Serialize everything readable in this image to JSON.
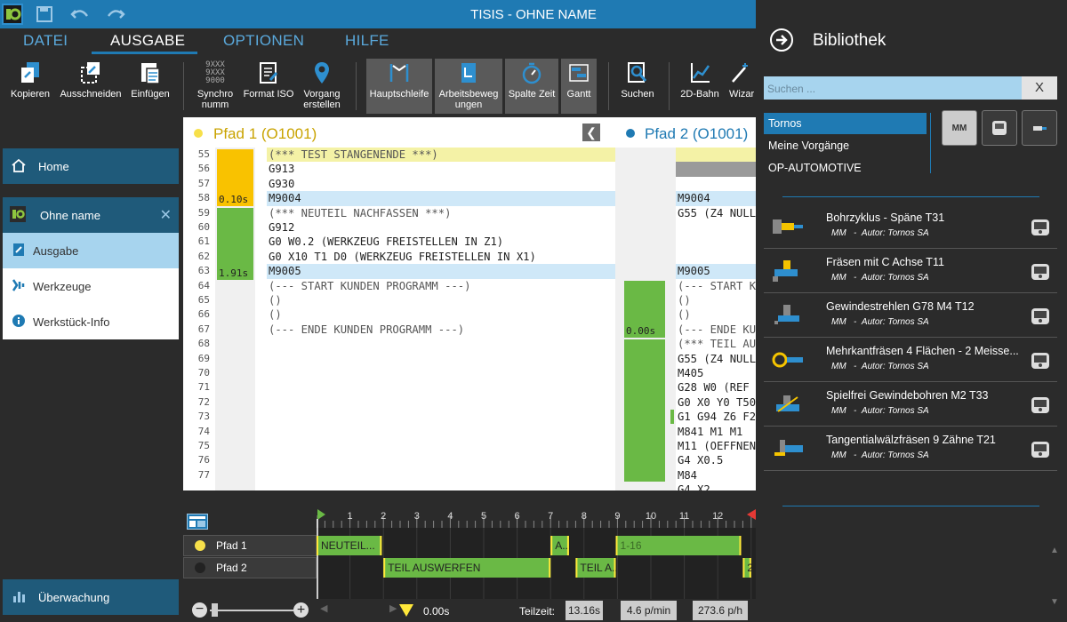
{
  "window": {
    "title": "TISIS - OHNE NAME"
  },
  "menu": {
    "tabs": [
      {
        "label": "DATEI"
      },
      {
        "label": "AUSGABE"
      },
      {
        "label": "OPTIONEN"
      },
      {
        "label": "HILFE"
      }
    ]
  },
  "ribbon": {
    "kopieren": "Kopieren",
    "ausschneiden": "Ausschneiden",
    "einfuegen": "Einfügen",
    "synchro": "Synchro\nnumm",
    "synchro_icon_text": "9XXX\n9XXX\n9000",
    "format_iso": "Format ISO",
    "vorgang": "Vorgang\nerstellen",
    "hauptschleife": "Hauptschleife",
    "arbeitsbewegungen": "Arbeitsbeweg\nungen",
    "spalte_zeit": "Spalte Zeit",
    "gantt": "Gantt",
    "suchen": "Suchen",
    "bahn2d": "2D-Bahn",
    "wizard": "Wizar"
  },
  "nav": {
    "home": "Home",
    "document": "Ohne name",
    "ausgabe": "Ausgabe",
    "werkzeuge": "Werkzeuge",
    "werkstueck": "Werkstück-Info",
    "ueberwachung": "Überwachung"
  },
  "path1": {
    "title": "Pfad 1 (O1001)",
    "dot_color": "#f7e04a",
    "time_a": "0.10s",
    "time_b": "1.91s",
    "lines": [
      {
        "n": "55",
        "code": "(*** TEST STANGENENDE ***)",
        "hl": "y"
      },
      {
        "n": "56",
        "code": "G913",
        "hl": ""
      },
      {
        "n": "57",
        "code": "G930",
        "hl": ""
      },
      {
        "n": "58",
        "code": "M9004",
        "hl": "b"
      },
      {
        "n": "59",
        "code": "(*** NEUTEIL NACHFASSEN ***)",
        "hl": ""
      },
      {
        "n": "60",
        "code": "G912",
        "hl": ""
      },
      {
        "n": "61",
        "code": "G0 W0.2 (WERKZEUG FREISTELLEN IN Z1)",
        "hl": ""
      },
      {
        "n": "62",
        "code": "G0 X10 T1 D0 (WERKZEUG FREISTELLEN IN X1)",
        "hl": ""
      },
      {
        "n": "63",
        "code": "M9005",
        "hl": "b"
      },
      {
        "n": "64",
        "code": "(--- START KUNDEN PROGRAMM ---)",
        "hl": ""
      },
      {
        "n": "65",
        "code": "()",
        "hl": ""
      },
      {
        "n": "66",
        "code": "()",
        "hl": ""
      },
      {
        "n": "67",
        "code": "(--- ENDE KUNDEN PROGRAMM ---)",
        "hl": ""
      },
      {
        "n": "68",
        "code": "",
        "hl": ""
      },
      {
        "n": "69",
        "code": "",
        "hl": ""
      },
      {
        "n": "70",
        "code": "",
        "hl": ""
      },
      {
        "n": "71",
        "code": "",
        "hl": ""
      },
      {
        "n": "72",
        "code": "",
        "hl": ""
      },
      {
        "n": "73",
        "code": "",
        "hl": ""
      },
      {
        "n": "74",
        "code": "",
        "hl": ""
      },
      {
        "n": "75",
        "code": "",
        "hl": ""
      },
      {
        "n": "76",
        "code": "",
        "hl": ""
      },
      {
        "n": "77",
        "code": "",
        "hl": ""
      }
    ]
  },
  "path2": {
    "title": "Pfad 2 (O1001)",
    "dot_color": "#1f7ab3",
    "time_a": "0.00s",
    "lines": [
      {
        "code": "",
        "hl": "y"
      },
      {
        "code": "",
        "hl": "g"
      },
      {
        "code": "",
        "hl": ""
      },
      {
        "code": "M9004",
        "hl": "b"
      },
      {
        "code": "G55 (Z4 NULL",
        "hl": ""
      },
      {
        "code": "",
        "hl": ""
      },
      {
        "code": "",
        "hl": ""
      },
      {
        "code": "",
        "hl": ""
      },
      {
        "code": "M9005",
        "hl": "b"
      },
      {
        "code": "(--- START K",
        "hl": ""
      },
      {
        "code": "()",
        "hl": ""
      },
      {
        "code": "()",
        "hl": ""
      },
      {
        "code": "(--- ENDE KU",
        "hl": ""
      },
      {
        "code": "(*** TEIL AU",
        "hl": ""
      },
      {
        "code": "G55 (Z4 NULL",
        "hl": ""
      },
      {
        "code": "M405",
        "hl": ""
      },
      {
        "code": "G28 W0 (REF",
        "hl": ""
      },
      {
        "code": "G0 X0 Y0 T50",
        "hl": ""
      },
      {
        "code": "G1 G94 Z6 F2",
        "hl": ""
      },
      {
        "code": "M841 M1 M1",
        "hl": ""
      },
      {
        "code": "M11 (OEFFNEN",
        "hl": ""
      },
      {
        "code": "G4 X0.5",
        "hl": ""
      },
      {
        "code": "M84",
        "hl": ""
      },
      {
        "code": "G4 X2",
        "hl": ""
      }
    ]
  },
  "gantt": {
    "ticks": [
      "1",
      "2",
      "3",
      "4",
      "5",
      "6",
      "7",
      "8",
      "9",
      "10",
      "11",
      "12"
    ],
    "rows": [
      {
        "label": "Pfad 1",
        "dot": "#f7e04a",
        "bars": [
          {
            "start": 0,
            "end": 1.95,
            "text": "NEUTEIL..."
          },
          {
            "start": 7.0,
            "end": 7.55,
            "text": "A..."
          },
          {
            "start": 8.95,
            "end": 12.7,
            "text": "1-16"
          }
        ]
      },
      {
        "label": "Pfad 2",
        "dot": "#222222",
        "bars": [
          {
            "start": 2.0,
            "end": 7.0,
            "text": "TEIL AUSWERFEN"
          },
          {
            "start": 7.75,
            "end": 8.95,
            "text": "TEIL A..."
          },
          {
            "start": 12.75,
            "end": 13.0,
            "text": "2..."
          }
        ]
      }
    ],
    "footer": {
      "time": "0.00s",
      "teilzeit_label": "Teilzeit:",
      "teilzeit": "13.16s",
      "rate_min": "4.6 p/min",
      "rate_h": "273.6 p/h"
    }
  },
  "library": {
    "title": "Bibliothek",
    "search_placeholder": "Suchen ...",
    "search_clear": "X",
    "categories": [
      "Tornos",
      "Meine Vorgänge",
      "OP-AUTOMOTIVE"
    ],
    "filter_mm": "MM",
    "items": [
      {
        "name": "Bohrzyklus - Späne T31",
        "unit": "MM",
        "sep": "-",
        "author": "Autor: Tornos SA"
      },
      {
        "name": "Fräsen mit C Achse T11",
        "unit": "MM",
        "sep": "-",
        "author": "Autor: Tornos SA"
      },
      {
        "name": "Gewindestrehlen G78 M4 T12",
        "unit": "MM",
        "sep": "-",
        "author": "Autor: Tornos SA"
      },
      {
        "name": "Mehrkantfräsen 4 Flächen - 2 Meisse...",
        "unit": "MM",
        "sep": "-",
        "author": "Autor: Tornos SA"
      },
      {
        "name": "Spielfrei Gewindebohren M2 T33",
        "unit": "MM",
        "sep": "-",
        "author": "Autor: Tornos SA"
      },
      {
        "name": "Tangentialwälzfräsen 9 Zähne T21",
        "unit": "MM",
        "sep": "-",
        "author": "Autor: Tornos SA"
      }
    ]
  }
}
